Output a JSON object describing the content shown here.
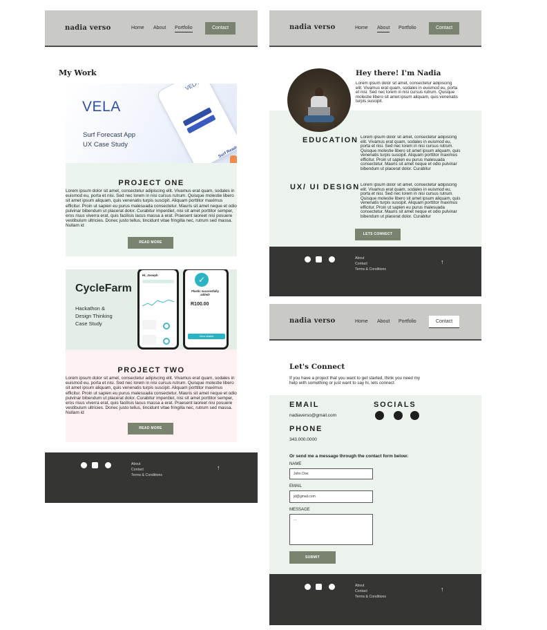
{
  "brand": "nadia verso",
  "nav": {
    "home": "Home",
    "about": "About",
    "portfolio": "Portfolio",
    "contact": "Contact"
  },
  "work": {
    "heading": "My Work",
    "project1": {
      "image_brand": "VELA",
      "image_subtitle": "Surf Forecast App\nUX Case Study",
      "phone_brand": "VELA",
      "phone_tag": "Surf Ready",
      "title": "PROJECT ONE",
      "text": "Lorem ipsum dolor sit amet, consectetur adipiscing elit. Vivamus erat quam, sodales in euismod eu, porta et nisi. Sed nec lorem in nisi cursus rutrum. Quisque molestie libero sit amet ipsum aliquam, quis venenatis turpis suscipit. Aliquam porttitor maximus efficitur. Proin ut sapien eu purus malesuada consectetur. Mauris sit amet neque et odio pulvinar bibendum ut placerat dolor. Curabitur imperdiet, nisi sit amet porttitor semper, eros risus viverra erat, quis facilisis lacus massa a erat. Praesent laoreet nisi posuere vestibulum ultricies. Donec justo tellus, tincidunt vitae fringilla nec, rutrum sed massa. Nullam id",
      "button": "READ MORE"
    },
    "project2": {
      "image_brand": "CycleFarm",
      "image_subtitle": "Hackathon &\nDesign Thinking\nCase Study",
      "phone_greeting": "Hi, Joseph",
      "phone_amount": "R100.00",
      "phone_status": "Plastic successfully added!",
      "phone_button": "View Wallet",
      "title": "PROJECT TWO",
      "text": "Lorem ipsum dolor sit amet, consectetur adipiscing elit. Vivamus erat quam, sodales in euismod eu, porta et nisi. Sed nec lorem in nisi cursus rutrum. Quisque molestie libero sit amet ipsum aliquam, quis venenatis turpis suscipit. Aliquam porttitor maximus efficitur. Proin ut sapien eu purus malesuada consectetur. Mauris sit amet neque et odio pulvinar bibendum ut placerat dolor. Curabitur imperdiet, nisi sit amet porttitor semper, eros risus viverra erat, quis facilisis lacus massa a erat. Praesent laoreet nisi posuere vestibulum ultricies. Donec justo tellus, tincidunt vitae fringilla nec, rutrum sed massa. Nullam id",
      "button": "READ MORE"
    }
  },
  "about": {
    "heading": "Hey there! I'm Nadia",
    "intro": "Lorem ipsum dolor sit amet, consectetur adipiscing elit. Vivamus erat quam, sodales in euismod eu, porta et nisi. Sed nec lorem in nisi cursus rutrum. Quisque molestie libero sit amet ipsum aliquam, quis venenatis turpis suscipit.",
    "education_heading": "EDUCATION",
    "education_text": "Lorem ipsum dolor sit amet, consectetur adipiscing elit. Vivamus erat quam, sodales in euismod eu, porta et nisi. Sed nec lorem in nisi cursus rutrum. Quisque molestie libero sit amet ipsum aliquam, quis venenatis turpis suscipit. Aliquam porttitor maximus efficitur. Proin ut sapien eu purus malesuada consectetur. Mauris sit amet neque et odio pulvinar bibendum ut placerat dolor. Curabitur",
    "ux_heading": "UX/ UI DESIGN",
    "ux_text": "Lorem ipsum dolor sit amet, consectetur adipiscing elit. Vivamus erat quam, sodales in euismod eu, porta et nisi. Sed nec lorem in nisi cursus rutrum. Quisque molestie libero sit amet ipsum aliquam, quis venenatis turpis suscipit. Aliquam porttitor maximus efficitur. Proin ut sapien eu purus malesuada consectetur. Mauris sit amet neque et odio pulvinar bibendum ut placerat dolor. Curabitur",
    "button": "LETS CONNECT"
  },
  "contact": {
    "heading": "Let's Connect",
    "intro": "If you have a project that you want to get started, think you need my help with something or just want to say hi, lets connect",
    "email_heading": "EMAIL",
    "email": "nadiaverso@gmail.com",
    "socials_heading": "SOCIALS",
    "phone_heading": "PHONE",
    "phone": "343.000.0000",
    "form_intro": "Or send me a message through the contact form below:",
    "name_label": "NAME",
    "name_value": "John Doe",
    "email_label": "EMAIL",
    "email_value": "jd@gmail.com",
    "message_label": "MESSAGE",
    "message_value": "...",
    "submit": "SUBMIT"
  },
  "footer": {
    "links": [
      "About",
      "Contact",
      "Terms & Conditions"
    ],
    "up_arrow": "↑",
    "icons": [
      "instagram-icon",
      "linkedin-icon",
      "pinterest-icon"
    ]
  },
  "colors": {
    "header": "#c9cac6",
    "accent": "#7a8270",
    "mint": "#ebf3ec",
    "pink": "#fdf1f2",
    "footer": "#353533"
  }
}
